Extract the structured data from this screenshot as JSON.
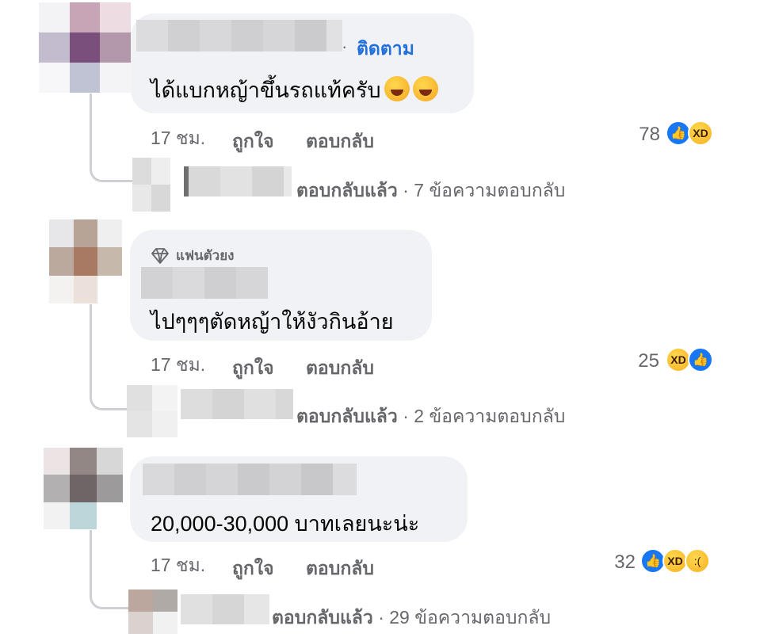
{
  "comments": [
    {
      "follow_dot": "·",
      "follow_label": "ติดตาม",
      "text": "ได้แบกหญ้าขึ้นรถแท้ครับ",
      "emoji_count": 2,
      "time": "17 ชม.",
      "like_label": "ถูกใจ",
      "reply_label": "ตอบกลับ",
      "reaction_count": "78",
      "reactions": [
        "like",
        "haha"
      ],
      "replies_summary": "ตอบกลับแล้ว",
      "replies_sep": "·",
      "replies_count": "7 ข้อความตอบกลับ"
    },
    {
      "badge": "แฟนตัวยง",
      "text": "ไปๆๆๆตัดหญ้าให้งัวกินอ้าย",
      "time": "17 ชม.",
      "like_label": "ถูกใจ",
      "reply_label": "ตอบกลับ",
      "reaction_count": "25",
      "reactions": [
        "haha",
        "like"
      ],
      "replies_summary": "ตอบกลับแล้ว",
      "replies_sep": "·",
      "replies_count": "2 ข้อความตอบกลับ"
    },
    {
      "text": "20,000-30,000 บาทเลยนะน่ะ",
      "time": "17 ชม.",
      "like_label": "ถูกใจ",
      "reply_label": "ตอบกลับ",
      "reaction_count": "32",
      "reactions": [
        "like",
        "haha",
        "sad"
      ],
      "replies_summary": "ตอบกลับแล้ว",
      "replies_sep": "·",
      "replies_count": "29 ข้อความตอบกลับ"
    }
  ],
  "colors": {
    "bubble": "#f0f2f5",
    "meta": "#65676b",
    "link": "#216fdb",
    "like": "#1877f2"
  }
}
